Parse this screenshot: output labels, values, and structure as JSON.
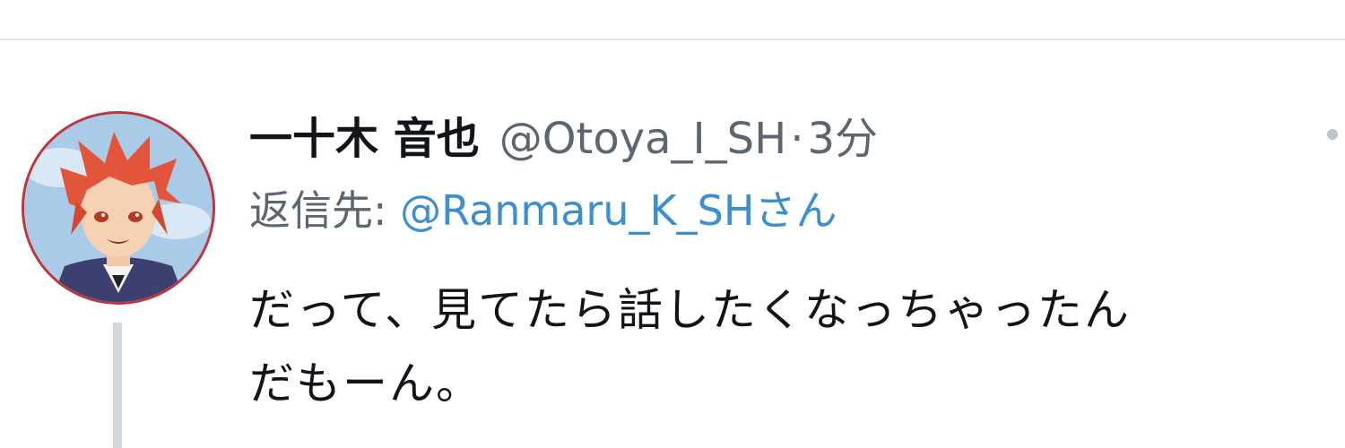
{
  "tweet": {
    "author": {
      "display_name": "一十木 音也",
      "handle": "@Otoya_I_SH"
    },
    "separator": "·",
    "time": "3分",
    "reply": {
      "prefix": "返信先: ",
      "target": "@Ranmaru_K_SHさん"
    },
    "text_line_1": "だって、見てたら話したくなっちゃったん",
    "text_line_2": "だもーん。"
  },
  "icons": {
    "more": "more-dots-icon",
    "avatar": "avatar-image"
  },
  "colors": {
    "link": "#3b8fd1",
    "secondary_text": "#5b6670",
    "primary_text": "#111418",
    "avatar_border": "#c0353a",
    "thread_line": "#cfd9de"
  }
}
